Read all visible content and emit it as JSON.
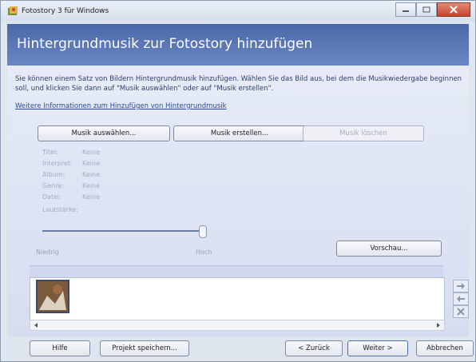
{
  "window": {
    "title": "Fotostory 3 für Windows"
  },
  "header": {
    "title": "Hintergrundmusik zur Fotostory hinzufügen"
  },
  "intro": "Sie können einem Satz von Bildern Hintergrundmusik hinzufügen. Wählen Sie das Bild aus, bei dem die Musikwiedergabe beginnen soll, und klicken Sie dann auf \"Musik auswählen\" oder auf \"Musik erstellen\".",
  "info_link": "Weitere Informationen zum Hinzufügen von Hintergrundmusik",
  "buttons": {
    "select_music": "Musik auswählen...",
    "create_music": "Musik erstellen...",
    "delete_music": "Musik löschen",
    "preview": "Vorschau...",
    "help": "Hilfe",
    "save_project": "Projekt speichern...",
    "back": "< Zurück",
    "next": "Weiter >",
    "cancel": "Abbrechen"
  },
  "meta": {
    "title_label": "Titel:",
    "title_value": "Keine",
    "artist_label": "Interpret:",
    "artist_value": "Keine",
    "album_label": "Album:",
    "album_value": "Keine",
    "genre_label": "Genre:",
    "genre_value": "Keine",
    "file_label": "Datei:",
    "file_value": "Keine",
    "volume_label": "Lautstärke:"
  },
  "slider": {
    "low_label": "Niedrig",
    "high_label": "Hoch",
    "value": 1.0
  },
  "colors": {
    "header": "#4b68a8",
    "content": "#e6ebf7"
  }
}
